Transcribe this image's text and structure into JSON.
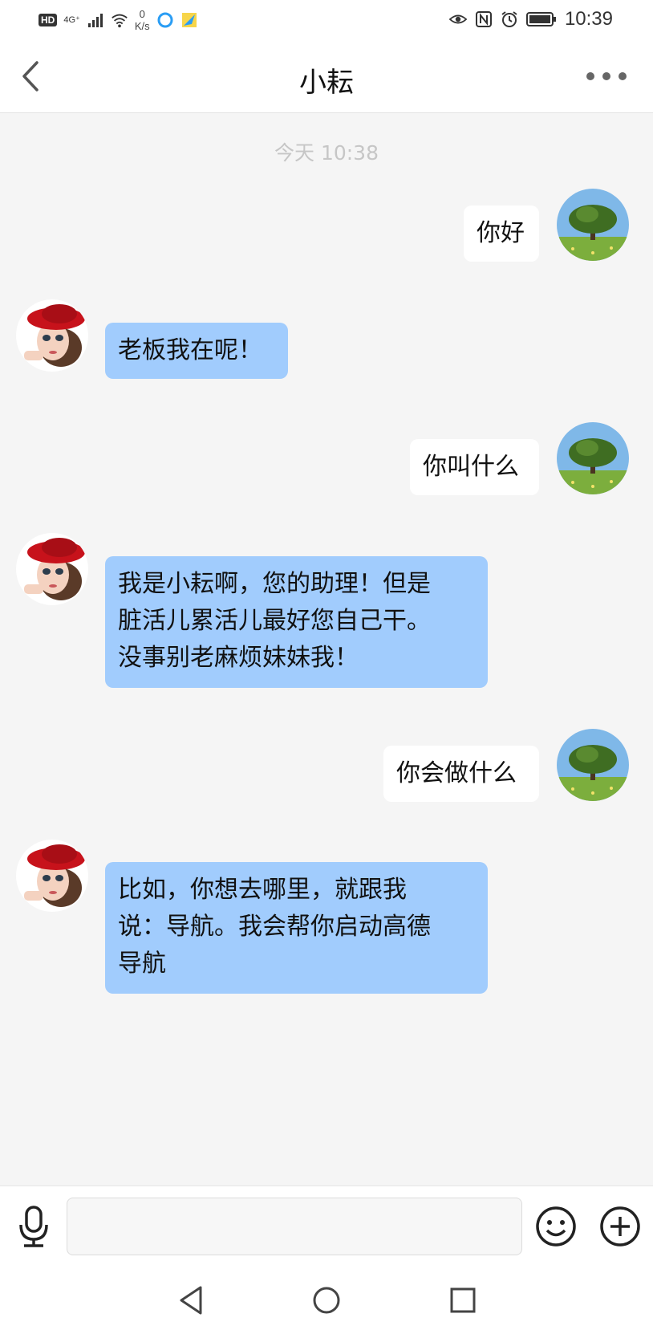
{
  "status_bar": {
    "hd": "HD",
    "network": "4G⁺",
    "speed_value": "0",
    "speed_unit": "K/s",
    "time": "10:39",
    "icons": [
      "signal-icon",
      "wifi-icon",
      "app-icon",
      "app-icon",
      "eye-icon",
      "nfc-icon",
      "alarm-icon",
      "battery-icon"
    ]
  },
  "header": {
    "title": "小耘",
    "back_icon": "chevron-left-icon",
    "more_icon": "more-dots-icon"
  },
  "chat": {
    "timestamp": "今天 10:38",
    "messages": [
      {
        "from": "me",
        "text": "你好"
      },
      {
        "from": "bot",
        "text": "老板我在呢！"
      },
      {
        "from": "me",
        "text": "你叫什么"
      },
      {
        "from": "bot",
        "text": "我是小耘啊，您的助理！但是\n脏活儿累活儿最好您自己干。\n没事别老麻烦妹妹我！"
      },
      {
        "from": "me",
        "text": "你会做什么"
      },
      {
        "from": "bot",
        "text": "比如，你想去哪里，就跟我\n说：导航。我会帮你启动高德\n导航"
      }
    ]
  },
  "input_bar": {
    "value": "",
    "mic_icon": "microphone-icon",
    "emoji_icon": "smiley-icon",
    "plus_icon": "plus-circle-icon"
  },
  "nav_bar": {
    "icons": [
      "nav-back-icon",
      "nav-home-icon",
      "nav-recent-icon"
    ]
  },
  "colors": {
    "bot_bubble": "#a1ccfd",
    "me_bubble": "#ffffff",
    "background": "#f5f5f5"
  }
}
